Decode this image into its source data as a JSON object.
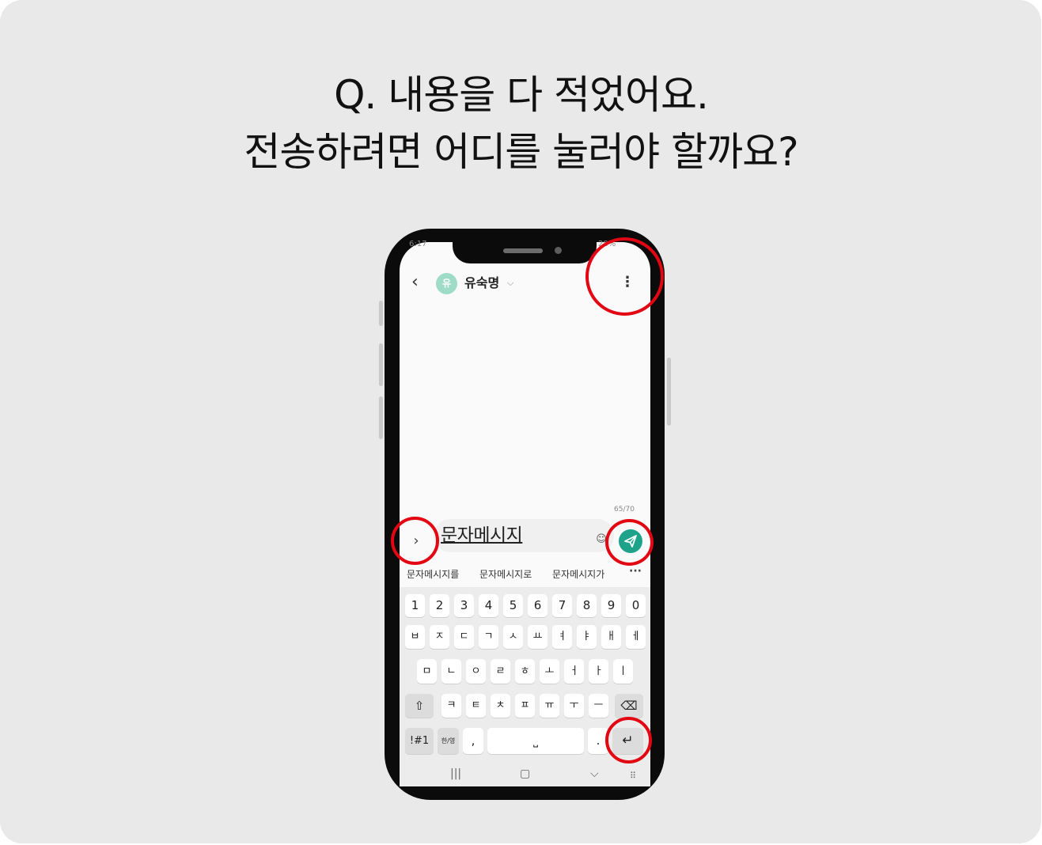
{
  "question": {
    "line1": "Q. 내용을 다 적었어요.",
    "line2": "전송하려면 어디를 눌러야 할까요?"
  },
  "status": {
    "time": "6:17",
    "battery": "28%"
  },
  "header": {
    "back_icon": "‹",
    "avatar_initial": "유",
    "contact_name": "유숙명",
    "dropdown_icon": "⌵",
    "more_icon": "⋮"
  },
  "composer": {
    "char_count": "65/70",
    "expand_icon": "›",
    "message_text": "문자메시지",
    "emoji_icon": "☺",
    "send_icon": "send-icon"
  },
  "suggestions": [
    "문자메시지를",
    "문자메시지로",
    "문자메시지가"
  ],
  "suggestions_more": "···",
  "keyboard": {
    "row1": [
      "1",
      "2",
      "3",
      "4",
      "5",
      "6",
      "7",
      "8",
      "9",
      "0"
    ],
    "row2": [
      "ㅂ",
      "ㅈ",
      "ㄷ",
      "ㄱ",
      "ㅅ",
      "ㅛ",
      "ㅕ",
      "ㅑ",
      "ㅐ",
      "ㅔ"
    ],
    "row3": [
      "ㅁ",
      "ㄴ",
      "ㅇ",
      "ㄹ",
      "ㅎ",
      "ㅗ",
      "ㅓ",
      "ㅏ",
      "ㅣ"
    ],
    "row4": [
      "ㅋ",
      "ㅌ",
      "ㅊ",
      "ㅍ",
      "ㅠ",
      "ㅜ",
      "ㅡ"
    ],
    "shift": "⇧",
    "backspace": "⌫",
    "symbols": "!#1",
    "lang": "한/영",
    "comma": ",",
    "space": "⎵",
    "period": ".",
    "enter": "↵"
  },
  "nav": {
    "recent": "|||",
    "home": "▢",
    "back": "⌵",
    "kbd": "⠿"
  },
  "colors": {
    "highlight": "#e30613",
    "send": "#1ea38a",
    "avatar": "#9fdcc8"
  }
}
